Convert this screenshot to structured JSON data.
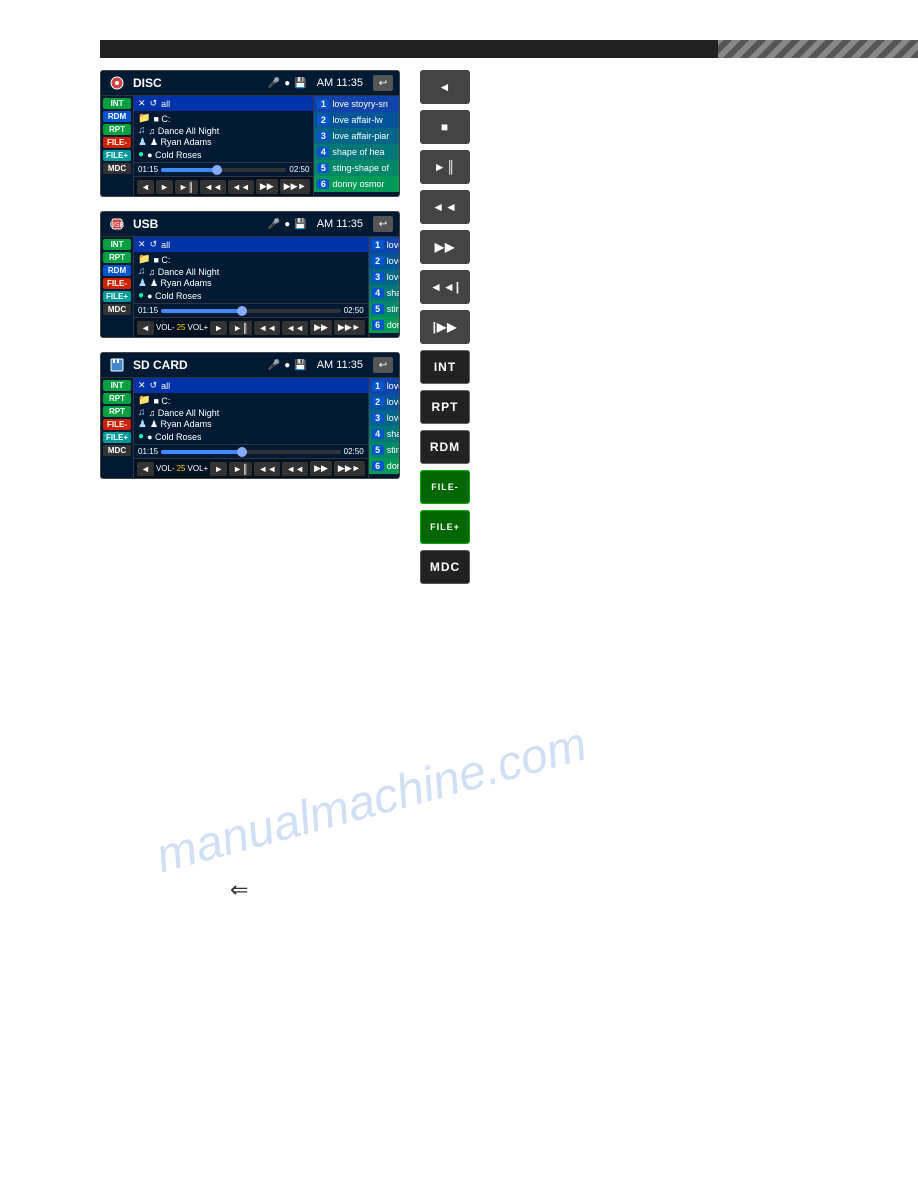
{
  "topBar": {
    "background": "#222"
  },
  "panels": [
    {
      "id": "disc-panel",
      "deviceType": "DISC",
      "deviceIconUnicode": "💿",
      "time": "AM 11:35",
      "sidebarButtons": [
        {
          "label": "INT",
          "color": "btn-green"
        },
        {
          "label": "RDM",
          "color": "btn-blue"
        },
        {
          "label": "RPT",
          "color": "btn-green"
        },
        {
          "label": "FILE-",
          "color": "btn-red"
        },
        {
          "label": "FILE+",
          "color": "btn-teal"
        },
        {
          "label": "MDC",
          "color": "btn-dark"
        }
      ],
      "topInfoRow": "✕ ↺ all",
      "folderLine1": "■ C:",
      "folderLine2": "♫ Dance All Night",
      "folderLine3": "♟ Ryan Adams",
      "folderLine4": "● Cold Roses",
      "timeStart": "01:15",
      "timeEnd": "02:50",
      "progressPercent": 45,
      "tracks": [
        {
          "num": "1",
          "name": "love stoyry-sn"
        },
        {
          "num": "2",
          "name": "love affair-lw"
        },
        {
          "num": "3",
          "name": "love affair-piar"
        },
        {
          "num": "4",
          "name": "shape of hea"
        },
        {
          "num": "5",
          "name": "sting-shape of"
        },
        {
          "num": "6",
          "name": "donny osmor"
        }
      ],
      "controls": [
        "◄",
        "■",
        "►║",
        "◄◄",
        "◄◄",
        "▶▶",
        "▶▶►"
      ]
    },
    {
      "id": "usb-panel",
      "deviceType": "USB",
      "deviceIconUnicode": "🔌",
      "time": "AM 11:35",
      "sidebarButtons": [
        {
          "label": "INT",
          "color": "btn-green"
        },
        {
          "label": "RPT",
          "color": "btn-green"
        },
        {
          "label": "RDM",
          "color": "btn-blue"
        },
        {
          "label": "FILE-",
          "color": "btn-red"
        },
        {
          "label": "FILE+",
          "color": "btn-teal"
        },
        {
          "label": "MDC",
          "color": "btn-dark"
        }
      ],
      "topInfoRow": "✕ ↺ all",
      "folderLine1": "■ C:",
      "folderLine2": "♫ Dance All Night",
      "folderLine3": "♟ Ryan Adams",
      "folderLine4": "● Cold Roses",
      "timeStart": "01:15",
      "timeEnd": "02:50",
      "progressPercent": 45,
      "tracks": [
        {
          "num": "1",
          "name": "love stoyry-sn"
        },
        {
          "num": "2",
          "name": "love affair-lw"
        },
        {
          "num": "3",
          "name": "love affair-piar"
        },
        {
          "num": "4",
          "name": "shape of my hea"
        },
        {
          "num": "5",
          "name": "sting-shape of"
        },
        {
          "num": "6",
          "name": "donny osmor"
        }
      ],
      "controls": [
        "◄",
        "VOL-",
        "25",
        "VOL+",
        "►",
        "►║",
        "◄◄",
        "◄◄",
        "▶▶",
        "▶▶►"
      ]
    },
    {
      "id": "sdcard-panel",
      "deviceType": "SD CARD",
      "deviceIconUnicode": "💾",
      "time": "AM 11:35",
      "sidebarButtons": [
        {
          "label": "INT",
          "color": "btn-green"
        },
        {
          "label": "RPT",
          "color": "btn-green"
        },
        {
          "label": "RPT",
          "color": "btn-green"
        },
        {
          "label": "FILE-",
          "color": "btn-red"
        },
        {
          "label": "FILE+",
          "color": "btn-teal"
        },
        {
          "label": "MDC",
          "color": "btn-dark"
        }
      ],
      "topInfoRow": "✕ ↺ all",
      "folderLine1": "■ C:",
      "folderLine2": "♫ Dance All Night",
      "folderLine3": "♟ Ryan Adams",
      "folderLine4": "● Cold Roses",
      "timeStart": "01:15",
      "timeEnd": "02:50",
      "progressPercent": 45,
      "tracks": [
        {
          "num": "1",
          "name": "love stoyry-sn"
        },
        {
          "num": "2",
          "name": "love affair-lw"
        },
        {
          "num": "3",
          "name": "love affair-piar"
        },
        {
          "num": "4",
          "name": "shape of my he"
        },
        {
          "num": "5",
          "name": "sting-shape of"
        },
        {
          "num": "6",
          "name": "donny osmor"
        }
      ],
      "controls": [
        "◄",
        "VOL-",
        "25",
        "VOL+",
        "►",
        "►║",
        "◄◄",
        "◄◄",
        "▶▶",
        "▶▶►"
      ]
    }
  ],
  "rightButtons": [
    {
      "label": "◄",
      "style": "dark",
      "name": "volume-down-button"
    },
    {
      "label": "■",
      "style": "dark",
      "name": "stop-button"
    },
    {
      "label": "►║",
      "style": "dark",
      "name": "play-pause-button"
    },
    {
      "label": "◄◄",
      "style": "dark",
      "name": "rewind-button"
    },
    {
      "label": "▶▶",
      "style": "dark",
      "name": "fast-forward-button"
    },
    {
      "label": "◄◄|",
      "style": "dark",
      "name": "prev-track-button"
    },
    {
      "label": "|▶▶",
      "style": "dark",
      "name": "next-track-button"
    },
    {
      "label": "INT",
      "style": "int-btn",
      "name": "int-button"
    },
    {
      "label": "RPT",
      "style": "rpt-btn",
      "name": "rpt-button"
    },
    {
      "label": "RDM",
      "style": "rdm-btn",
      "name": "rdm-button"
    },
    {
      "label": "FILE-",
      "style": "file-minus",
      "name": "file-minus-button"
    },
    {
      "label": "FILE+",
      "style": "file-plus",
      "name": "file-plus-button"
    },
    {
      "label": "MDC",
      "style": "mdc-btn",
      "name": "mdc-button"
    }
  ],
  "watermark": "manualmachine.com",
  "backArrow": "⇐"
}
